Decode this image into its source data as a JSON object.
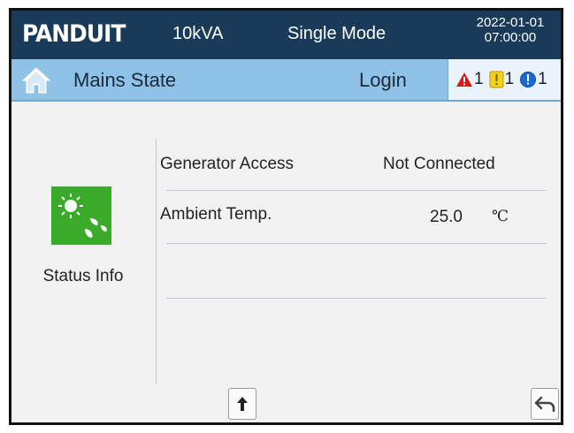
{
  "header": {
    "brand": "PANDUIT",
    "rating": "10kVA",
    "mode": "Single Mode",
    "date": "2022-01-01",
    "time": "07:00:00"
  },
  "statebar": {
    "title": "Mains State",
    "login_label": "Login",
    "alarms": [
      {
        "icon": "red-alarm-triangle-icon",
        "count": "1",
        "color": "#d41a1a"
      },
      {
        "icon": "yellow-warning-icon",
        "count": "1",
        "color": "#f2d21a"
      },
      {
        "icon": "blue-info-icon",
        "count": "1",
        "color": "#1a6ad4"
      }
    ]
  },
  "sidebar": {
    "status_label": "Status Info",
    "status_color": "#3aaa2a"
  },
  "table": {
    "rows": [
      {
        "label": "Generator Access",
        "value": "Not Connected"
      },
      {
        "label": "Ambient Temp.",
        "value": "25.0",
        "unit": "℃"
      }
    ]
  },
  "nav": {
    "up_icon": "arrow-up-icon",
    "back_icon": "return-arrow-icon"
  }
}
